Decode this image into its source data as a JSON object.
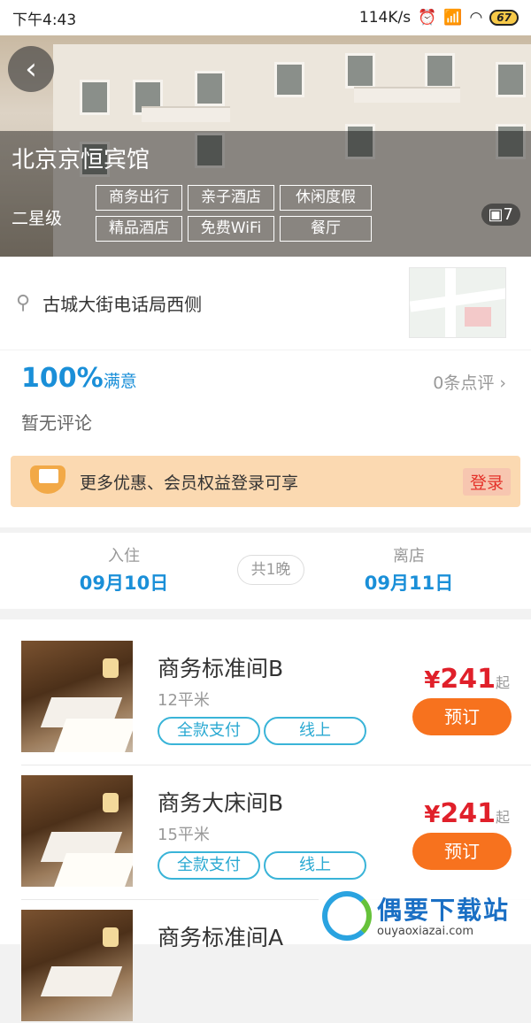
{
  "status_bar": {
    "time": "下午4:43",
    "network_speed": "114K/s",
    "battery": "67"
  },
  "hero": {
    "hotel_name": "北京京恒宾馆",
    "star_level": "二星级",
    "tags": [
      "商务出行",
      "亲子酒店",
      "休闲度假",
      "精品酒店",
      "免费WiFi",
      "餐厅"
    ],
    "photo_count": "7",
    "back_icon": "chevron-left-icon"
  },
  "address": {
    "text": "古城大街电话局西侧",
    "icon": "location-pin-icon"
  },
  "rating": {
    "percent": "100%",
    "label": "满意",
    "review_count": "0条点评",
    "no_review": "暂无评论"
  },
  "promo": {
    "text": "更多优惠、会员权益登录可享",
    "login": "登录"
  },
  "dates": {
    "checkin_label": "入住",
    "checkin_date": "09月10日",
    "nights": "共1晚",
    "checkout_label": "离店",
    "checkout_date": "09月11日"
  },
  "rooms": [
    {
      "name": "商务标准间B",
      "area": "12平米",
      "tags": [
        "全款支付",
        "线上"
      ],
      "currency": "¥",
      "price": "241",
      "suffix": "起",
      "book": "预订"
    },
    {
      "name": "商务大床间B",
      "area": "15平米",
      "tags": [
        "全款支付",
        "线上"
      ],
      "currency": "¥",
      "price": "241",
      "suffix": "起",
      "book": "预订"
    },
    {
      "name": "商务标准间A"
    }
  ],
  "watermark": {
    "title": "偶要下载站",
    "url": "ouyaoxiazai.com"
  },
  "colors": {
    "accent_blue": "#1a8fd8",
    "price_red": "#e0202a",
    "book_orange": "#f7721e",
    "promo_bg": "#fbd9b1"
  }
}
